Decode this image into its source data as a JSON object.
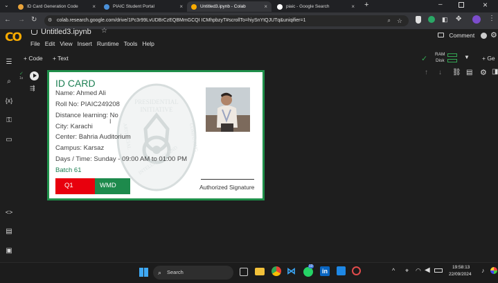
{
  "browser": {
    "tabs": [
      {
        "title": "ID Card Generation Code",
        "icon_color": "#e8a33a"
      },
      {
        "title": "PIAIC Student Portal",
        "icon_color": "#4a90d9"
      },
      {
        "title": "Untitled3.ipynb - Colab",
        "icon_color": "#f9ab00"
      },
      {
        "title": "piaic - Google Search",
        "icon_color": "#ffffff"
      }
    ],
    "new_tab_icon": "+",
    "url": "colab.research.google.com/drive/1Pc3r99LvUDBrCzEQBMmGCQI ICMhpbzyT#scrollTo=hiySnYtQJUTq&uniqifier=1"
  },
  "colab": {
    "logo_text": "CO",
    "notebook_title": "Untitled3.ipynb",
    "menu": [
      "File",
      "Edit",
      "View",
      "Insert",
      "Runtime",
      "Tools",
      "Help"
    ],
    "comment_label": "Comment",
    "add_code_label": "+ Code",
    "add_text_label": "+ Text",
    "ram_label": "RAM",
    "disk_label": "Disk",
    "cell_exec_time": "1s",
    "gemini_label": "+ Ge"
  },
  "id_card": {
    "title": "ID CARD",
    "name": "Name: Ahmed Ali",
    "roll_no": "Roll No: PIAIC249208",
    "distance_learning": "Distance learning: No",
    "city": "City: Karachi",
    "center": "Center: Bahria Auditorium",
    "campus": "Campus: Karsaz",
    "days_time": "Days / Time: Sunday - 09:00 AM to 01:00 PM",
    "batch": "Batch 61",
    "badge_1": "Q1",
    "badge_2": "WMD",
    "signature_label": "Authorized Signature",
    "watermark_top": "PRESIDENTIAL",
    "watermark_initiative": "INITIATIVE",
    "watermark_left": "ARTIFICIAL",
    "watermark_bottom": "INTELLIGENCE AND",
    "watermark_right": "COMPUTING",
    "colors": {
      "accent_green": "#1d7f53",
      "border_green": "#1f8f4a",
      "badge_red": "#e8000d",
      "badge_green": "#1d8a4c"
    }
  },
  "taskbar": {
    "search_placeholder": "Search",
    "time": "19:58:13",
    "date": "22/09/2024",
    "badge_count": "10"
  }
}
